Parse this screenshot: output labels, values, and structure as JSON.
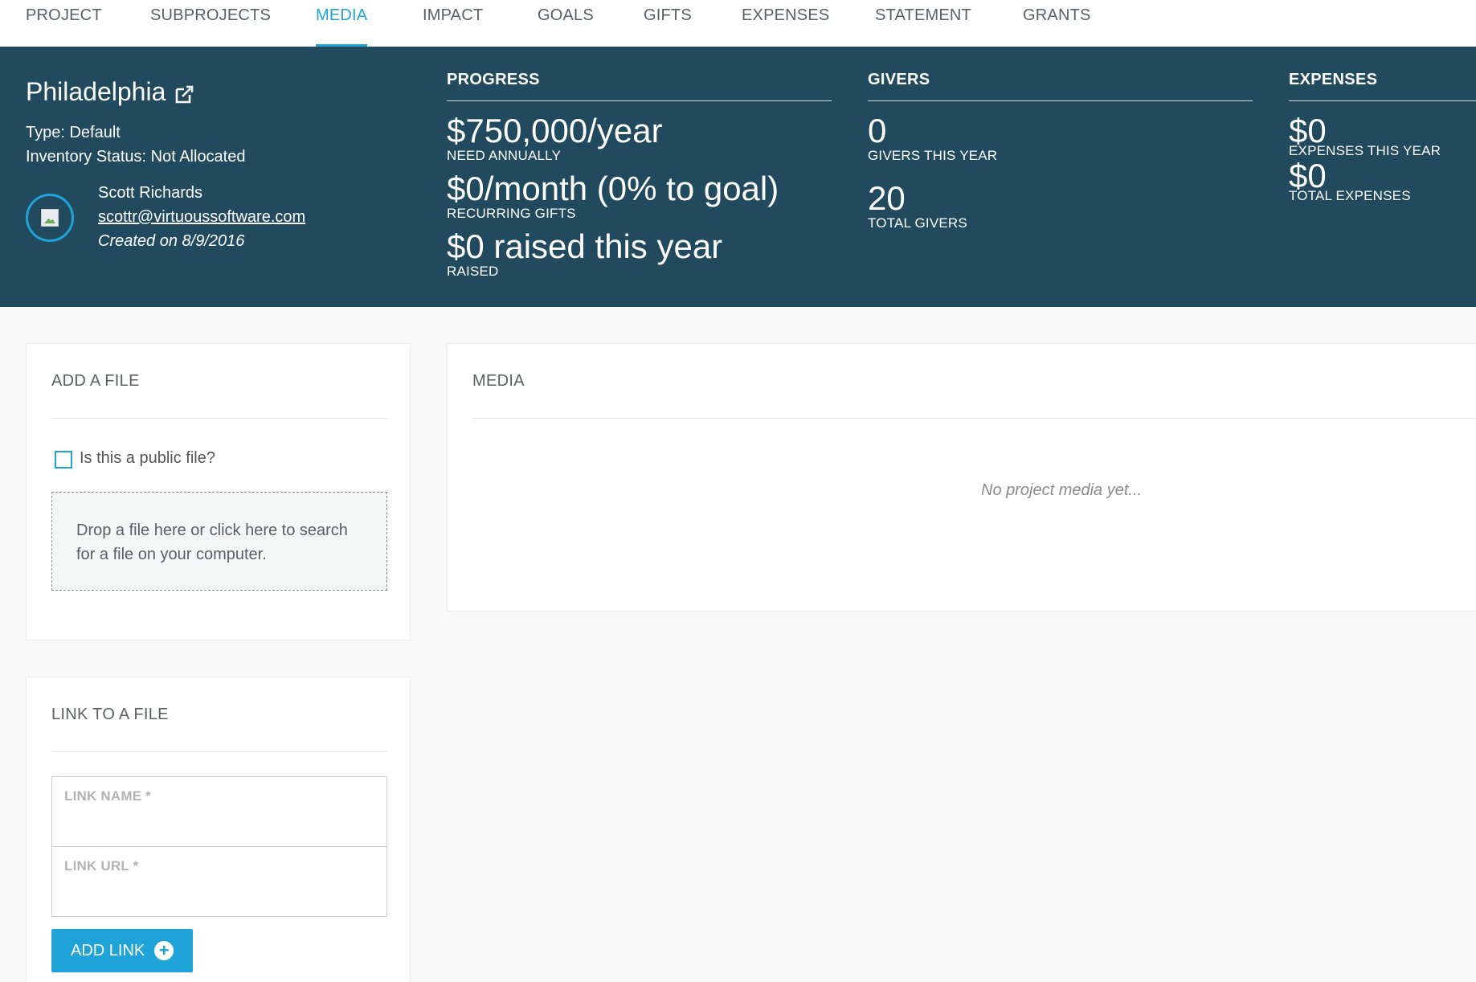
{
  "nav": {
    "tabs": [
      {
        "label": "PROJECT"
      },
      {
        "label": "SUBPROJECTS"
      },
      {
        "label": "MEDIA"
      },
      {
        "label": "IMPACT"
      },
      {
        "label": "GOALS"
      },
      {
        "label": "GIFTS"
      },
      {
        "label": "EXPENSES"
      },
      {
        "label": "STATEMENT"
      },
      {
        "label": "GRANTS"
      }
    ],
    "active_tab": "MEDIA"
  },
  "project": {
    "name": "Philadelphia",
    "type": "Type: Default",
    "inventory_status": "Inventory Status: Not Allocated",
    "owner_name": "Scott Richards",
    "owner_email": "scottr@virtuoussoftware.com",
    "created": "Created on 8/9/2016"
  },
  "progress": {
    "heading": "PROGRESS",
    "need_annually": "$750,000/year",
    "need_annually_caption": "NEED ANNUALLY",
    "recurring": "$0/month (0% to goal)",
    "recurring_caption": "RECURRING GIFTS",
    "raised": "$0 raised this year",
    "raised_caption": "RAISED"
  },
  "givers": {
    "heading": "GIVERS",
    "this_year": "0",
    "this_year_caption": "GIVERS THIS YEAR",
    "total": "20",
    "total_caption": "TOTAL GIVERS"
  },
  "expenses": {
    "heading": "EXPENSES",
    "this_year": "$0",
    "this_year_caption": "EXPENSES THIS YEAR",
    "total": "$0",
    "total_caption": "TOTAL EXPENSES"
  },
  "add_file": {
    "title": "ADD A FILE",
    "public_label": "Is this a public file?",
    "public_checked": false,
    "dropzone_text": "Drop a file here or click here to search for a file on your computer."
  },
  "media": {
    "title": "MEDIA",
    "empty_message": "No project media yet..."
  },
  "link_file": {
    "title": "LINK TO A FILE",
    "name_label": "LINK NAME *",
    "name_value": "",
    "url_label": "LINK URL *",
    "url_value": "",
    "add_button_label": "ADD LINK"
  },
  "colors": {
    "accent": "#1fa3d8",
    "header_bg": "#224a5e",
    "page_bg": "#f8f8f8"
  },
  "icons": {
    "edit": "edit-icon",
    "add": "plus-circle-icon",
    "avatar": "broken-image-icon"
  }
}
